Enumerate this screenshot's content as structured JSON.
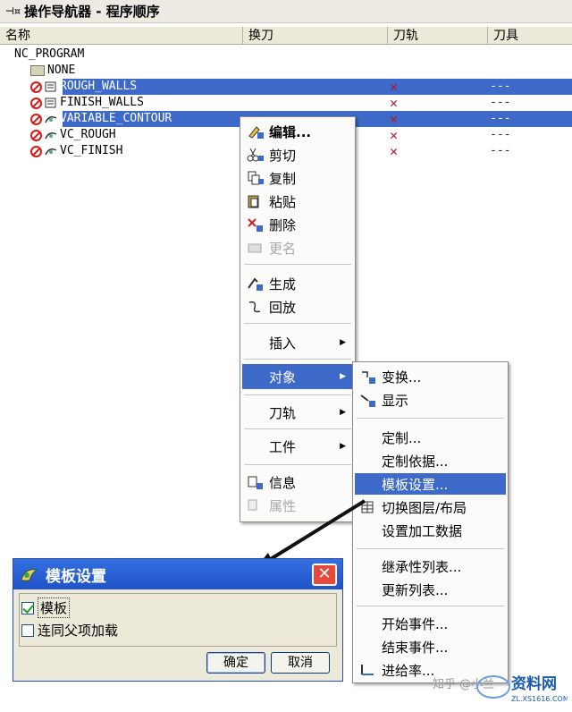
{
  "window": {
    "title": "操作导航器 - 程序顺序"
  },
  "columns": {
    "name": "名称",
    "tool_change": "换刀",
    "tool_path": "刀轨",
    "tool": "刀具"
  },
  "tree": {
    "program": "NC_PROGRAM",
    "group": "NONE",
    "operations": [
      {
        "name": "ROUGH_WALLS",
        "path_mark": "✕",
        "tool": "---",
        "selected": true
      },
      {
        "name": "FINISH_WALLS",
        "path_mark": "✕",
        "tool": "---",
        "selected": false
      },
      {
        "name": "VARIABLE_CONTOUR",
        "path_mark": "✕",
        "tool": "---",
        "selected": true
      },
      {
        "name": "VC_ROUGH",
        "path_mark": "✕",
        "tool": "---",
        "selected": false
      },
      {
        "name": "VC_FINISH",
        "path_mark": "✕",
        "tool": "---",
        "selected": false
      }
    ]
  },
  "context_menu": {
    "edit": "编辑...",
    "cut": "剪切",
    "copy": "复制",
    "paste": "粘贴",
    "delete": "删除",
    "rename": "更名",
    "generate": "生成",
    "replay": "回放",
    "insert": "插入",
    "object": "对象",
    "tool_path": "刀轨",
    "workpiece": "工件",
    "info": "信息",
    "properties": "属性"
  },
  "submenu": {
    "transform": "变换...",
    "display": "显示",
    "customize": "定制...",
    "custom_basis": "定制依据...",
    "template_setup": "模板设置...",
    "switch_layer": "切换图层/布局",
    "set_mfg_data": "设置加工数据",
    "inheritance_list": "继承性列表...",
    "update_list": "更新列表...",
    "start_events": "开始事件...",
    "end_events": "结束事件...",
    "feedrate": "进给率..."
  },
  "dialog": {
    "title": "模板设置",
    "close": "✕",
    "template_checkbox": "模板",
    "template_checked": true,
    "load_with_parent": "连同父项加载",
    "load_with_parent_checked": false,
    "ok": "确定",
    "cancel": "取消"
  },
  "watermark": {
    "text": "知乎 @小兰"
  },
  "colors": {
    "selection": "#3d69c8",
    "red_x": "#b4182d"
  }
}
